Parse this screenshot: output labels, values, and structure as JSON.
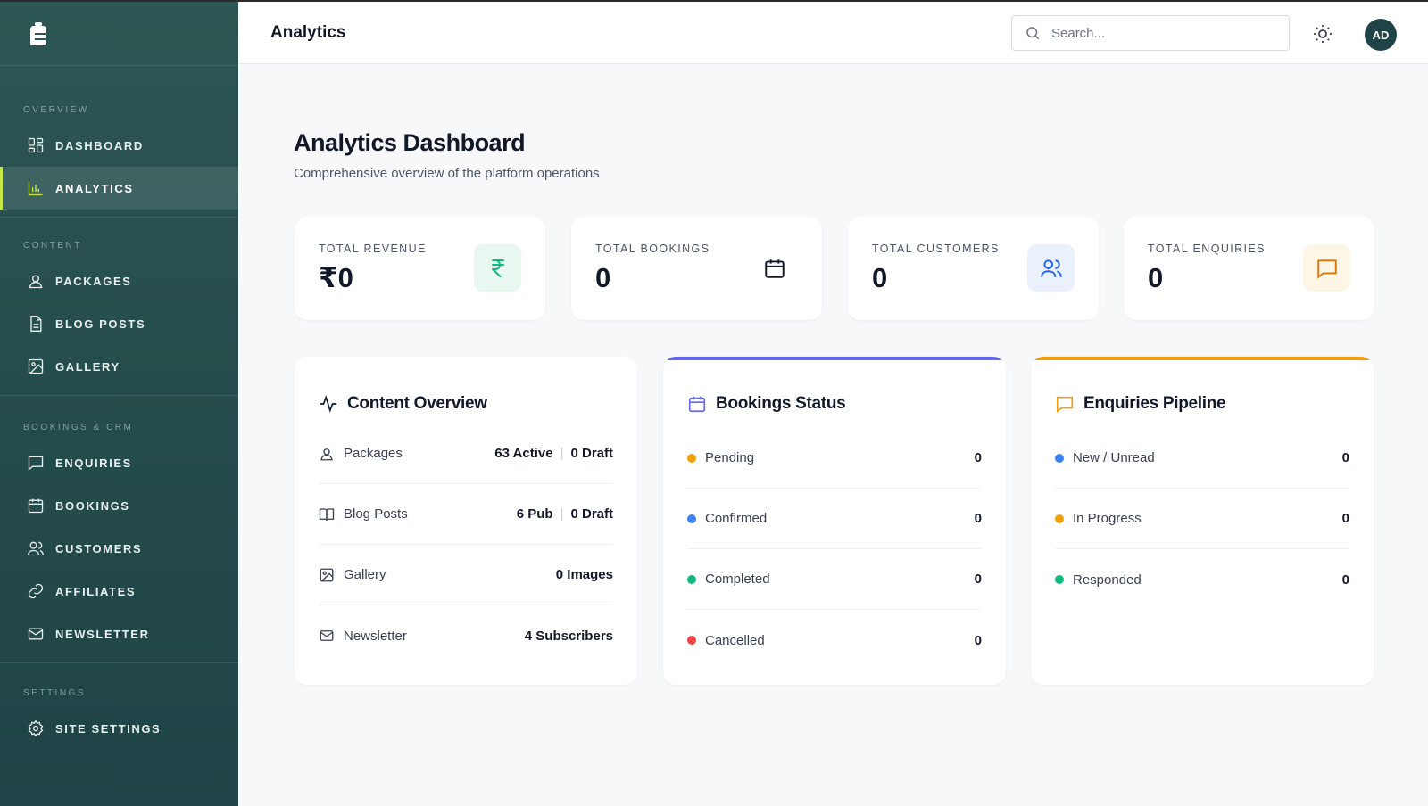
{
  "header": {
    "title": "Analytics",
    "search_placeholder": "Search...",
    "avatar_initials": "AD"
  },
  "sidebar": {
    "sections": [
      {
        "label": "OVERVIEW",
        "items": [
          {
            "label": "DASHBOARD",
            "icon": "dashboard-icon"
          },
          {
            "label": "ANALYTICS",
            "icon": "bar-chart-icon",
            "active": true
          }
        ]
      },
      {
        "label": "CONTENT",
        "items": [
          {
            "label": "PACKAGES",
            "icon": "package-icon"
          },
          {
            "label": "BLOG POSTS",
            "icon": "document-icon"
          },
          {
            "label": "GALLERY",
            "icon": "image-icon"
          }
        ]
      },
      {
        "label": "BOOKINGS & CRM",
        "items": [
          {
            "label": "ENQUIRIES",
            "icon": "message-icon"
          },
          {
            "label": "BOOKINGS",
            "icon": "calendar-icon"
          },
          {
            "label": "CUSTOMERS",
            "icon": "users-icon"
          },
          {
            "label": "AFFILIATES",
            "icon": "link-icon"
          },
          {
            "label": "NEWSLETTER",
            "icon": "mail-icon"
          }
        ]
      },
      {
        "label": "SETTINGS",
        "items": [
          {
            "label": "SITE SETTINGS",
            "icon": "gear-icon"
          }
        ]
      }
    ]
  },
  "main": {
    "title": "Analytics Dashboard",
    "subtitle": "Comprehensive overview of the platform operations",
    "stats": [
      {
        "label": "TOTAL REVENUE",
        "value": "₹0",
        "icon": "rupee-icon",
        "icon_color": "#10b981",
        "icon_bg": "#e8f8f1"
      },
      {
        "label": "TOTAL BOOKINGS",
        "value": "0",
        "icon": "calendar-icon",
        "icon_color": "#111827",
        "icon_bg": "#ffffff"
      },
      {
        "label": "TOTAL CUSTOMERS",
        "value": "0",
        "icon": "users-icon",
        "icon_color": "#2563eb",
        "icon_bg": "#eaf1fd"
      },
      {
        "label": "TOTAL ENQUIRIES",
        "value": "0",
        "icon": "message-icon",
        "icon_color": "#d97706",
        "icon_bg": "#fdf6e7"
      }
    ],
    "content_overview": {
      "title": "Content Overview",
      "rows": [
        {
          "label": "Packages",
          "value1": "63 Active",
          "value2": "0 Draft"
        },
        {
          "label": "Blog Posts",
          "value1": "6 Pub",
          "value2": "0 Draft"
        },
        {
          "label": "Gallery",
          "value1": "0 Images"
        },
        {
          "label": "Newsletter",
          "value1": "4 Subscribers"
        }
      ]
    },
    "bookings_status": {
      "title": "Bookings Status",
      "accent": "#6366f1",
      "rows": [
        {
          "label": "Pending",
          "value": "0",
          "color": "#f59e0b"
        },
        {
          "label": "Confirmed",
          "value": "0",
          "color": "#3b82f6"
        },
        {
          "label": "Completed",
          "value": "0",
          "color": "#10b981"
        },
        {
          "label": "Cancelled",
          "value": "0",
          "color": "#ef4444"
        }
      ]
    },
    "enquiries_pipeline": {
      "title": "Enquiries Pipeline",
      "accent": "#f59e0b",
      "rows": [
        {
          "label": "New / Unread",
          "value": "0",
          "color": "#3b82f6"
        },
        {
          "label": "In Progress",
          "value": "0",
          "color": "#f59e0b"
        },
        {
          "label": "Responded",
          "value": "0",
          "color": "#10b981"
        }
      ]
    }
  }
}
